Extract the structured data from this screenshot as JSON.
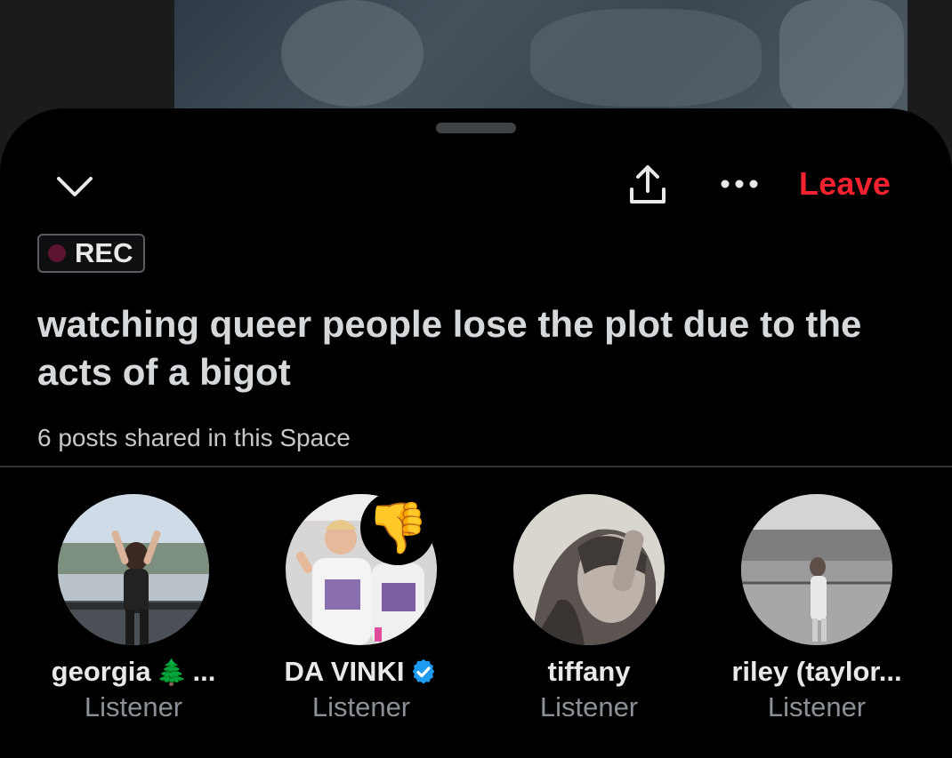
{
  "header": {
    "leave_label": "Leave",
    "leave_color": "#f4212e"
  },
  "recording": {
    "label": "REC"
  },
  "space": {
    "title": "watching queer people lose the plot due to the acts of a bigot",
    "posts_shared": "6 posts shared in this Space"
  },
  "listeners": [
    {
      "name": "georgia",
      "emoji": "🌲",
      "suffix": "...",
      "role": "Listener"
    },
    {
      "name": "DA VINKI",
      "verified": true,
      "role": "Listener",
      "reaction": "👎"
    },
    {
      "name": "tiffany",
      "role": "Listener"
    },
    {
      "name": "riley (taylor...",
      "role": "Listener"
    }
  ],
  "icons": [
    "chevron-down-icon",
    "share-icon",
    "more-icon",
    "verified-badge-icon",
    "tree-emoji",
    "thumbs-down-reaction"
  ]
}
